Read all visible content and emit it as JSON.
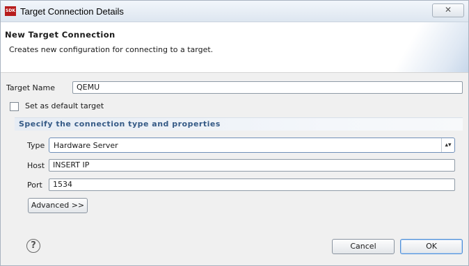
{
  "window": {
    "title": "Target Connection Details",
    "app_icon_text": "SDK",
    "close_glyph": "✕"
  },
  "banner": {
    "title": "New Target Connection",
    "description": "Creates new configuration for connecting to a target."
  },
  "target_name": {
    "label": "Target Name",
    "value": "QEMU"
  },
  "default_target": {
    "label": "Set as default target",
    "checked": false
  },
  "connection": {
    "section_title": "Specify the connection type and properties",
    "type_label": "Type",
    "type_value": "Hardware Server",
    "host_label": "Host",
    "host_value": "INSERT IP",
    "port_label": "Port",
    "port_value": "1534"
  },
  "buttons": {
    "advanced": "Advanced >>",
    "cancel": "Cancel",
    "ok": "OK",
    "help": "?"
  },
  "icons": {
    "app": "sdk-icon",
    "close": "close-icon",
    "dropdown": "dropdown-arrows-icon",
    "help": "help-icon"
  }
}
